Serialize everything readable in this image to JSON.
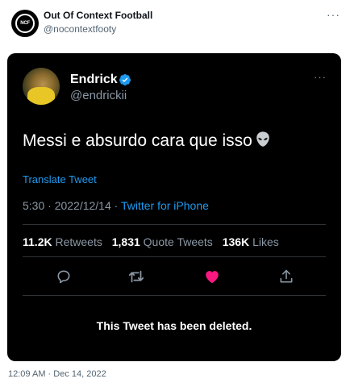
{
  "outer_post": {
    "avatar_text": "NCF",
    "display_name": "Out Of Context Football",
    "handle": "@nocontextfooty",
    "more_icon": "more-horizontal-icon",
    "timestamp": "12:09 AM · Dec 14, 2022"
  },
  "embedded_tweet": {
    "display_name": "Endrick",
    "verified_icon": "verified-badge-icon",
    "handle": "@endrickii",
    "text": "Messi e absurdo cara que isso",
    "emoji_icon": "alien-emoji-icon",
    "translate_label": "Translate Tweet",
    "time_date": "5:30 · 2022/12/14 · ",
    "source": "Twitter for iPhone",
    "stats": {
      "retweets_count": "11.2K",
      "retweets_label": "Retweets",
      "quotes_count": "1,831",
      "quotes_label": "Quote Tweets",
      "likes_count": "136K",
      "likes_label": "Likes"
    },
    "actions": [
      "reply-icon",
      "retweet-icon",
      "like-icon",
      "share-icon"
    ],
    "like_color": "#f91880",
    "deleted_notice": "This Tweet has been deleted."
  },
  "colors": {
    "accent": "#1d9bf0",
    "card_background": "#000000",
    "secondary_text": "#8b98a5"
  }
}
